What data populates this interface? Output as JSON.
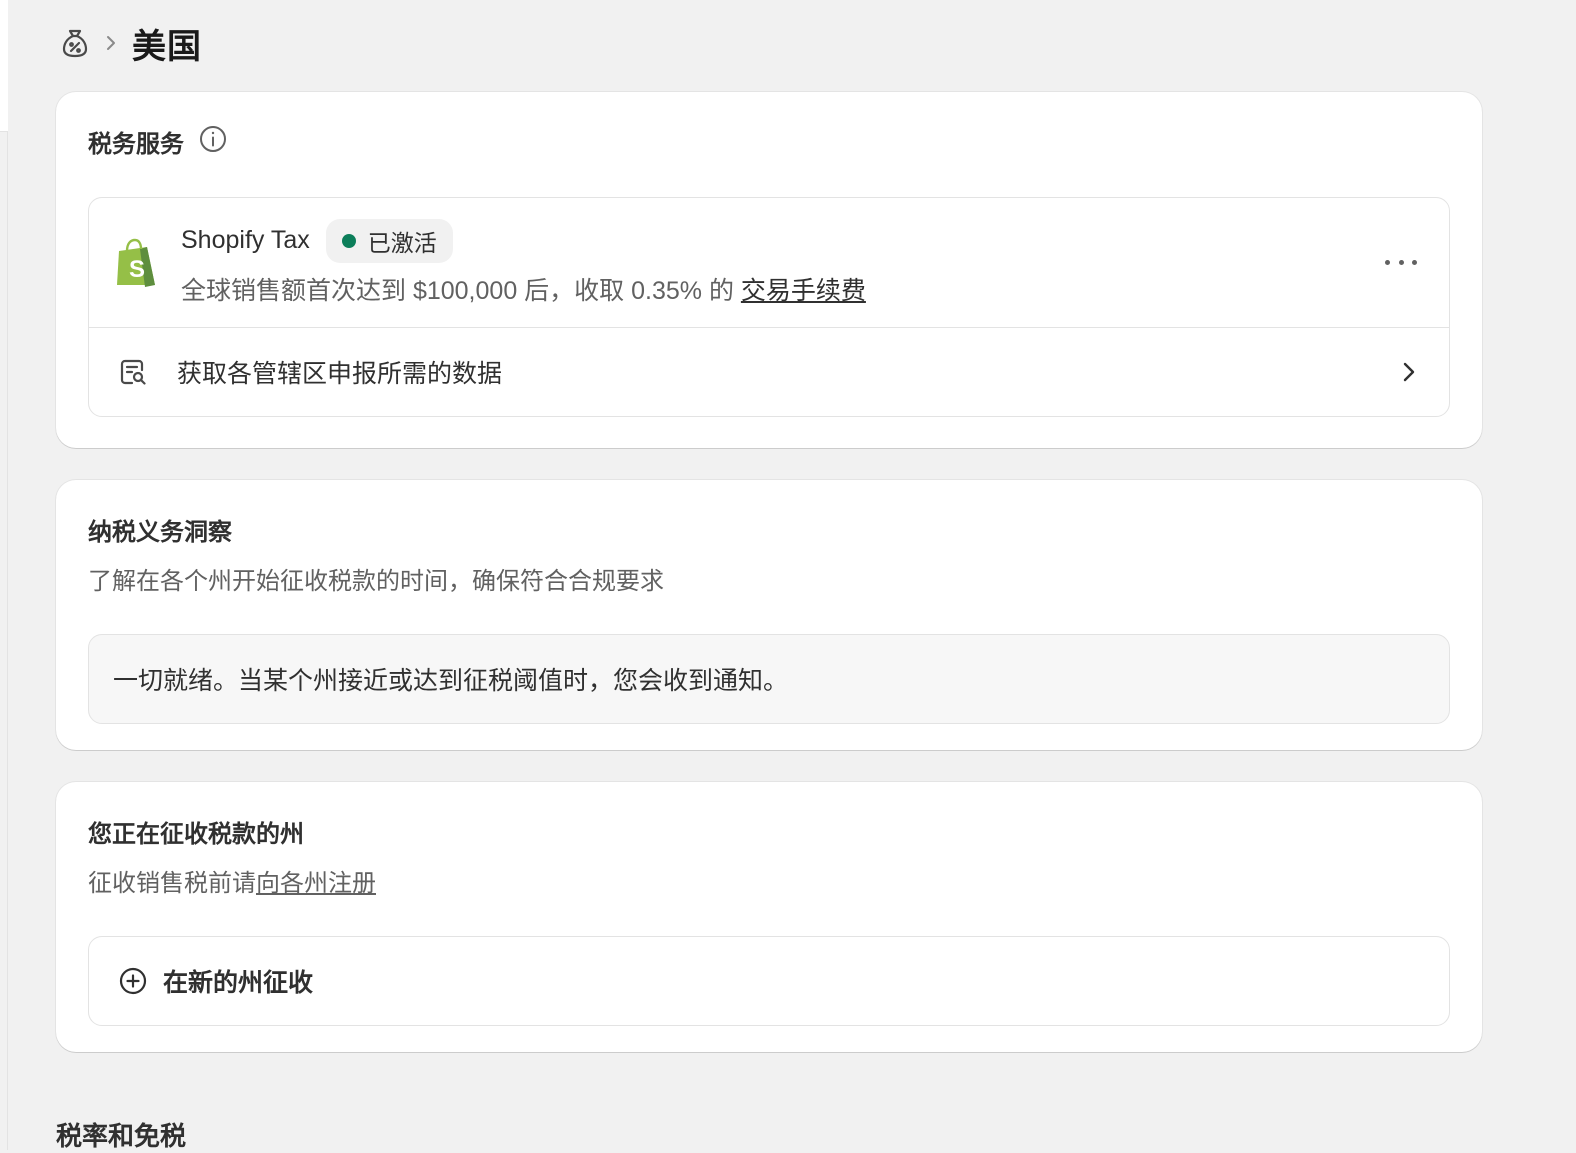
{
  "breadcrumb": {
    "root_icon": "tax-bag-icon",
    "separator_icon": "chevron-right-icon",
    "title": "美国"
  },
  "tax_service": {
    "title": "税务服务",
    "info_icon": "info-icon",
    "provider": {
      "logo_icon": "shopify-bag-icon",
      "name": "Shopify Tax",
      "status": "已激活",
      "status_color": "#0c7e5a",
      "description": "全球销售额首次达到 $100,000 后，收取 0.35% 的 ",
      "fee_link": "交易手续费",
      "more_icon": "more-horizontal-icon"
    },
    "report_link": {
      "icon": "report-search-icon",
      "label": "获取各管辖区申报所需的数据",
      "chevron_icon": "chevron-right-icon"
    }
  },
  "insights": {
    "title": "纳税义务洞察",
    "subtitle": "了解在各个州开始征收税款的时间，确保符合合规要求",
    "banner": "一切就绪。当某个州接近或达到征税阈值时，您会收到通知。"
  },
  "collecting_states": {
    "title": "您正在征收税款的州",
    "subtitle_prefix": "征收销售税前请",
    "register_link": "向各州注册",
    "add_button": "在新的州征收",
    "add_icon": "plus-circle-icon"
  },
  "rates_section": {
    "title": "税率和免税"
  }
}
